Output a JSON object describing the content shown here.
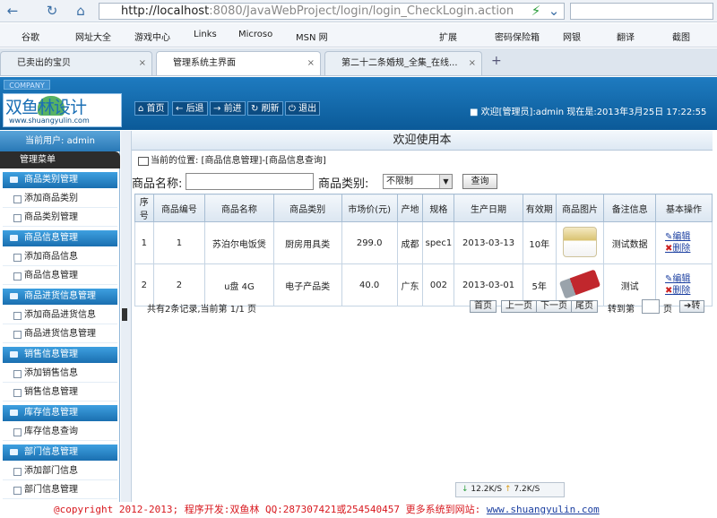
{
  "browser": {
    "url_host": "http://localhost",
    "url_rest": ":8080/JavaWebProject/login/login_CheckLogin.action",
    "bookmarks": [
      "谷歌",
      "网址大全",
      "游戏中心",
      "Links",
      "Microso",
      "MSN 网",
      "扩展",
      "密码保险箱",
      "网银",
      "翻译",
      "截图"
    ],
    "tabs": [
      "已卖出的宝贝",
      "管理系统主界面",
      "第二十二条婚规_全集_在线..."
    ]
  },
  "header": {
    "company": "COMPANY",
    "logo_main": "双鱼林设计",
    "logo_sub": "www.shuangyulin.com",
    "buttons": [
      "首页",
      "后退",
      "前进",
      "刷新",
      "退出"
    ],
    "welcome": "欢迎[管理员]:admin 现在是:2013年3月25日 17:22:55"
  },
  "sidebar": {
    "current_user": "当前用户: admin",
    "menu_title": "管理菜单",
    "sections": [
      {
        "title": "商品类别管理",
        "items": [
          "添加商品类别",
          "商品类别管理"
        ]
      },
      {
        "title": "商品信息管理",
        "items": [
          "添加商品信息",
          "商品信息管理"
        ]
      },
      {
        "title": "商品进货信息管理",
        "items": [
          "添加商品进货信息",
          "商品进货信息管理"
        ]
      },
      {
        "title": "销售信息管理",
        "items": [
          "添加销售信息",
          "销售信息管理"
        ]
      },
      {
        "title": "库存信息管理",
        "items": [
          "库存信息查询"
        ]
      },
      {
        "title": "部门信息管理",
        "items": [
          "添加部门信息",
          "部门信息管理"
        ]
      }
    ]
  },
  "content": {
    "title": "欢迎使用本",
    "position": "当前的位置: [商品信息管理]-[商品信息查询]",
    "filter": {
      "name_label": "商品名称:",
      "cat_label": "商品类别:",
      "cat_value": "不限制",
      "query": "查询"
    },
    "columns": [
      "序号",
      "商品编号",
      "商品名称",
      "商品类别",
      "市场价(元)",
      "产地",
      "规格",
      "生产日期",
      "有效期",
      "商品图片",
      "备注信息",
      "基本操作"
    ],
    "rows": [
      {
        "no": "1",
        "code": "1",
        "name": "苏泊尔电饭煲",
        "cat": "厨房用具类",
        "price": "299.0",
        "origin": "成都",
        "spec": "spec1",
        "date": "2013-03-13",
        "valid": "10年",
        "note": "测试数据",
        "edit": "编辑",
        "del": "删除"
      },
      {
        "no": "2",
        "code": "2",
        "name": "u盘 4G",
        "cat": "电子产品类",
        "price": "40.0",
        "origin": "广东",
        "spec": "002",
        "date": "2013-03-01",
        "valid": "5年",
        "note": "测试",
        "edit": "编辑",
        "del": "删除"
      }
    ],
    "pager": {
      "summary": "共有2条记录,当前第 1/1 页",
      "first": "首页",
      "prev": "上一页",
      "next": "下一页",
      "last": "尾页",
      "goto": "转到第",
      "page": "页",
      "go": "转"
    }
  },
  "status": {
    "down": "12.2K/S",
    "up": "7.2K/S"
  },
  "footer": {
    "text": "@copyright 2012-2013; 程序开发:双鱼林  QQ:287307421或254540457  更多系统到网站: ",
    "link": "www.shuangyulin.com"
  }
}
